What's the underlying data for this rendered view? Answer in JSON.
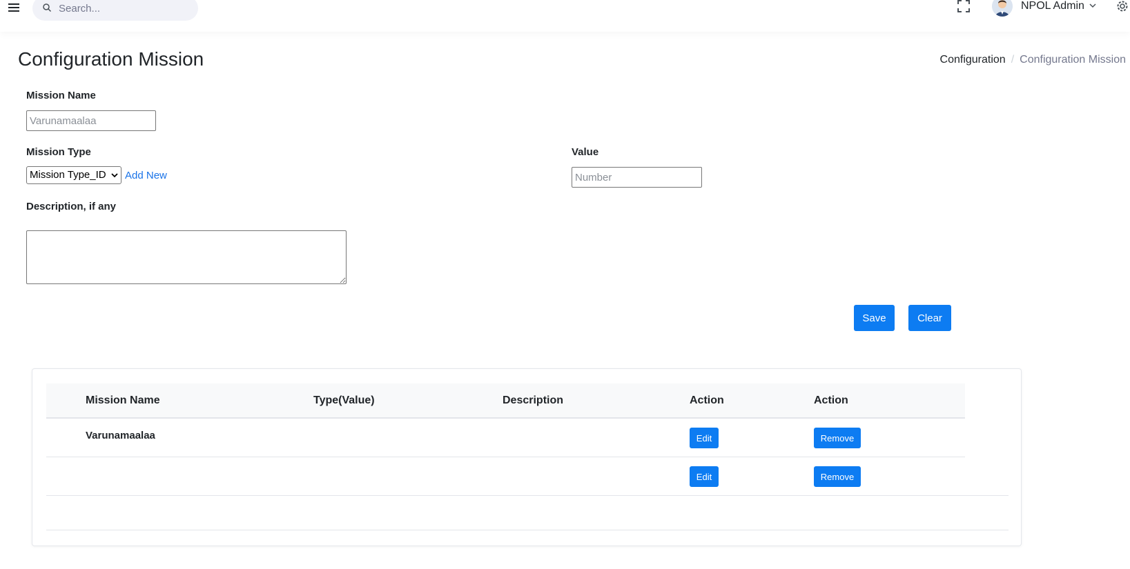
{
  "header": {
    "search_placeholder": "Search...",
    "user_name": "NPOL Admin"
  },
  "page": {
    "title": "Configuration Mission",
    "breadcrumb": [
      "Configuration",
      "Configuration Mission"
    ],
    "breadcrumb_separator": "/"
  },
  "form": {
    "mission_name_label": "Mission Name",
    "mission_name_placeholder": "Varunamaalaa",
    "mission_type_label": "Mission Type",
    "mission_type_selected": "Mission Type_ID",
    "add_new_label": "Add New",
    "value_label": "Value",
    "value_placeholder": "Number",
    "description_label": "Description, if any",
    "save_label": "Save",
    "clear_label": "Clear"
  },
  "table": {
    "columns": [
      "Mission Name",
      "Type(Value)",
      "Description",
      "Action",
      "Action"
    ],
    "rows": [
      {
        "mission_name": "Varunamaalaa",
        "type_value": "",
        "description": "",
        "edit_label": "Edit",
        "remove_label": "Remove"
      },
      {
        "mission_name": "",
        "type_value": "",
        "description": "",
        "edit_label": "Edit",
        "remove_label": "Remove"
      }
    ]
  },
  "colors": {
    "primary": "#0d7cf2",
    "link": "#1a73e8",
    "search_bg": "#f1f2f8"
  },
  "icons": [
    "hamburger-icon",
    "search-icon",
    "fullscreen-icon",
    "avatar",
    "chevron-down-icon",
    "gear-icon"
  ]
}
